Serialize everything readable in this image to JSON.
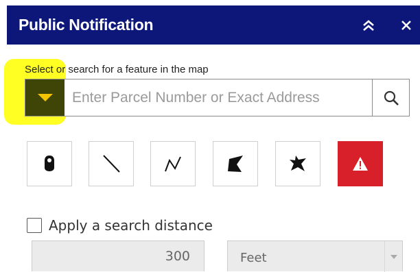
{
  "panel": {
    "title": "Public Notification",
    "collapse_icon": "double-chevron-up-icon",
    "close_icon": "close-icon"
  },
  "search": {
    "prompt": "Select or search for a feature in the map",
    "placeholder": "Enter Parcel Number or Exact Address",
    "value": "",
    "dropdown_icon": "caret-down-icon",
    "search_icon": "magnifier-icon"
  },
  "tools": [
    {
      "name": "point",
      "icon": "point-pin-icon"
    },
    {
      "name": "line",
      "icon": "line-icon"
    },
    {
      "name": "polyline",
      "icon": "polyline-icon"
    },
    {
      "name": "polygon",
      "icon": "polygon-icon"
    },
    {
      "name": "freehand-polygon",
      "icon": "freehand-polygon-icon"
    },
    {
      "name": "clear",
      "icon": "warning-icon"
    }
  ],
  "distance": {
    "checkbox_label": "Apply a search distance",
    "checked": false,
    "value": "300",
    "unit": "Feet"
  },
  "colors": {
    "header_bg": "#0c1779",
    "highlight": "#ffff24",
    "dropdown_bg": "#3f4407",
    "dropdown_arrow": "#f4c400",
    "clear_button": "#d8202a"
  }
}
